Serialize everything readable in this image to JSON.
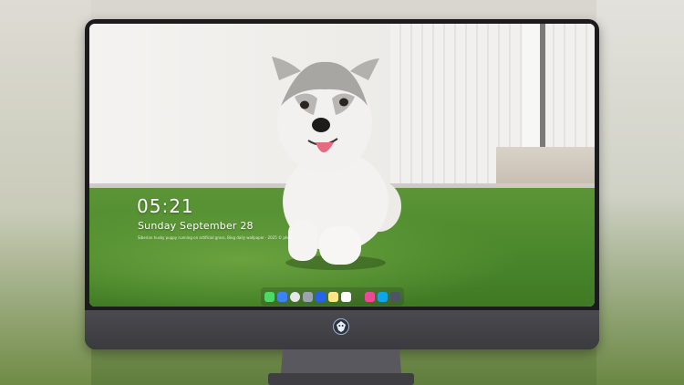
{
  "lockscreen": {
    "time": "05:21",
    "date": "Sunday September 28",
    "caption": "Siberian husky puppy running on artificial grass, Bing daily wallpaper · 2025 © photographer"
  },
  "dock": {
    "items": [
      {
        "name": "messages",
        "color": "#4cd964"
      },
      {
        "name": "files",
        "color": "#3b82f6"
      },
      {
        "name": "clock",
        "color": "#e5e7eb"
      },
      {
        "name": "app-store",
        "color": "#6b7280"
      },
      {
        "name": "video",
        "color": "#2563eb"
      },
      {
        "name": "notes",
        "color": "#fbbf24"
      },
      {
        "name": "photos",
        "color": "#ffffff"
      },
      {
        "name": "music",
        "color": "#ec4899"
      },
      {
        "name": "browser",
        "color": "#0ea5e9"
      },
      {
        "name": "screenshot",
        "color": "#374151"
      }
    ]
  },
  "colors": {
    "bezel": "#1b1b1e",
    "chin": "#45454a",
    "grass": "#4d8a2d"
  }
}
